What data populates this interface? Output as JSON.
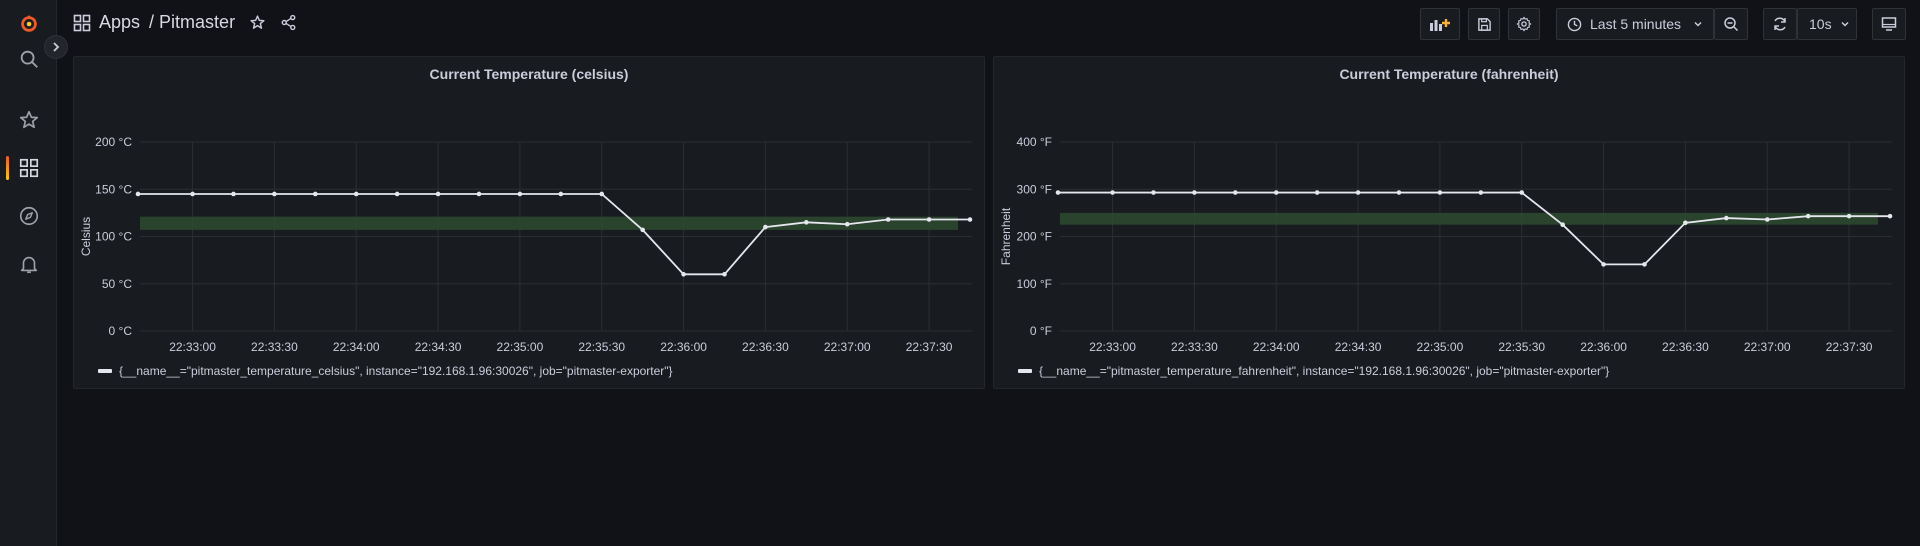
{
  "breadcrumb": {
    "folder": "Apps",
    "separator": "/",
    "dashboard": "Pitmaster"
  },
  "toolbar": {
    "time_range": "Last 5 minutes",
    "refresh_interval": "10s"
  },
  "sidemenu": {
    "icons": [
      "grafana-logo-icon",
      "search-icon",
      "starred-icon",
      "dashboards-icon",
      "explore-icon",
      "alerting-icon"
    ]
  },
  "colors": {
    "background": "#111217",
    "panel": "#181b1f",
    "series": "#e6e6ef",
    "threshold_band": "#2e4a30",
    "accent": "#f05a28"
  },
  "panels": [
    {
      "title": "Current Temperature (celsius)",
      "legend": "{__name__=\"pitmaster_temperature_celsius\", instance=\"192.168.1.96:30026\", job=\"pitmaster-exporter\"}",
      "chart_data": {
        "type": "line",
        "ylabel": "Celsius",
        "unit": "°C",
        "ylim": [
          0,
          200
        ],
        "yticks": [
          "0 °C",
          "50 °C",
          "100 °C",
          "150 °C",
          "200 °C"
        ],
        "xticks": [
          "22:33:00",
          "22:33:30",
          "22:34:00",
          "22:34:30",
          "22:35:00",
          "22:35:30",
          "22:36:00",
          "22:36:30",
          "22:37:00",
          "22:37:30"
        ],
        "band": [
          107,
          121
        ],
        "grid": true,
        "series": [
          {
            "x": [
              "22:32:40",
              "22:33:00",
              "22:33:15",
              "22:33:30",
              "22:33:45",
              "22:34:00",
              "22:34:15",
              "22:34:30",
              "22:34:45",
              "22:35:00",
              "22:35:15",
              "22:35:30",
              "22:35:45",
              "22:36:00",
              "22:36:15",
              "22:36:30",
              "22:36:45",
              "22:37:00",
              "22:37:15",
              "22:37:30",
              "22:37:45"
            ],
            "values": [
              145,
              145,
              145,
              145,
              145,
              145,
              145,
              145,
              145,
              145,
              145,
              145,
              107,
              60,
              60,
              110,
              115,
              113,
              118,
              118,
              118
            ]
          }
        ]
      }
    },
    {
      "title": "Current Temperature (fahrenheit)",
      "legend": "{__name__=\"pitmaster_temperature_fahrenheit\", instance=\"192.168.1.96:30026\", job=\"pitmaster-exporter\"}",
      "chart_data": {
        "type": "line",
        "ylabel": "Fahrenheit",
        "unit": "°F",
        "ylim": [
          0,
          400
        ],
        "yticks": [
          "0 °F",
          "100 °F",
          "200 °F",
          "300 °F",
          "400 °F"
        ],
        "xticks": [
          "22:33:00",
          "22:33:30",
          "22:34:00",
          "22:34:30",
          "22:35:00",
          "22:35:30",
          "22:36:00",
          "22:36:30",
          "22:37:00",
          "22:37:30"
        ],
        "band": [
          225,
          250
        ],
        "grid": true,
        "series": [
          {
            "x": [
              "22:32:40",
              "22:33:00",
              "22:33:15",
              "22:33:30",
              "22:33:45",
              "22:34:00",
              "22:34:15",
              "22:34:30",
              "22:34:45",
              "22:35:00",
              "22:35:15",
              "22:35:30",
              "22:35:45",
              "22:36:00",
              "22:36:15",
              "22:36:30",
              "22:36:45",
              "22:37:00",
              "22:37:15",
              "22:37:30",
              "22:37:45"
            ],
            "values": [
              293,
              293,
              293,
              293,
              293,
              293,
              293,
              293,
              293,
              293,
              293,
              293,
              225,
              141,
              141,
              229,
              239,
              236,
              243,
              243,
              243
            ]
          }
        ]
      }
    }
  ]
}
